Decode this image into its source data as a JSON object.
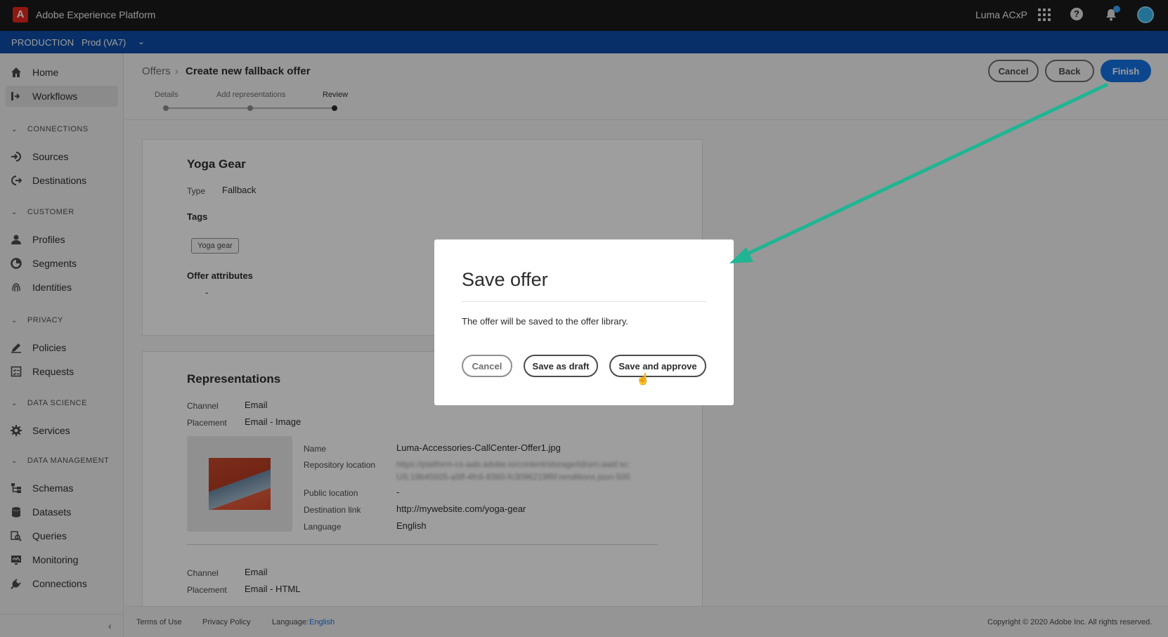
{
  "topbar": {
    "logo": "A",
    "app_title": "Adobe Experience Platform",
    "org_name": "Luma ACxP",
    "help_glyph": "?"
  },
  "envbar": {
    "environment": "PRODUCTION",
    "sandbox": "Prod (VA7)"
  },
  "sidebar": {
    "items": [
      {
        "label": "Home",
        "icon": "home-icon"
      },
      {
        "label": "Workflows",
        "icon": "workflows-icon",
        "active": true
      },
      {
        "section": "CONNECTIONS"
      },
      {
        "label": "Sources",
        "icon": "sources-icon"
      },
      {
        "label": "Destinations",
        "icon": "destinations-icon"
      },
      {
        "section": "CUSTOMER"
      },
      {
        "label": "Profiles",
        "icon": "profiles-icon"
      },
      {
        "label": "Segments",
        "icon": "segments-icon"
      },
      {
        "label": "Identities",
        "icon": "identities-icon"
      },
      {
        "section": "PRIVACY"
      },
      {
        "label": "Policies",
        "icon": "policies-icon"
      },
      {
        "label": "Requests",
        "icon": "requests-icon"
      },
      {
        "section": "DATA SCIENCE"
      },
      {
        "label": "Services",
        "icon": "services-icon"
      },
      {
        "section": "DATA MANAGEMENT"
      },
      {
        "label": "Schemas",
        "icon": "schemas-icon"
      },
      {
        "label": "Datasets",
        "icon": "datasets-icon"
      },
      {
        "label": "Queries",
        "icon": "queries-icon"
      },
      {
        "label": "Monitoring",
        "icon": "monitoring-icon"
      },
      {
        "label": "Connections",
        "icon": "connections-icon"
      }
    ]
  },
  "header": {
    "breadcrumb_root": "Offers",
    "breadcrumb_current": "Create new fallback offer",
    "steps": [
      "Details",
      "Add representations",
      "Review"
    ],
    "current_step": 3,
    "cancel_label": "Cancel",
    "back_label": "Back",
    "finish_label": "Finish"
  },
  "offer": {
    "name": "Yoga Gear",
    "type_label": "Type",
    "type_value": "Fallback",
    "tags_heading": "Tags",
    "tags": [
      "Yoga gear"
    ],
    "attributes_heading": "Offer attributes",
    "attributes_value": "-"
  },
  "representations": {
    "heading": "Representations",
    "channel_label": "Channel",
    "placement_label": "Placement",
    "items": [
      {
        "channel": "Email",
        "placement": "Email - Image",
        "name_label": "Name",
        "name": "Luma-Accessories-CallCenter-Offer1.jpg",
        "repo_label": "Repository location",
        "repo_line1": "https://platform-cs-aab.adobe.io/content/storage/id/urn:aaid:sc:",
        "repo_line2": "US:19b45505-a5ff-4fc6-8360-fc3096219f6f:renditions.json-500",
        "public_label": "Public location",
        "public_value": "-",
        "dest_label": "Destination link",
        "dest_value": "http://mywebsite.com/yoga-gear",
        "lang_label": "Language",
        "lang_value": "English"
      },
      {
        "channel": "Email",
        "placement": "Email - HTML"
      }
    ]
  },
  "footer": {
    "terms": "Terms of Use",
    "privacy": "Privacy Policy",
    "language_label": "Language:",
    "language_value": "English",
    "copyright": "Copyright ©  2020 Adobe Inc. All rights reserved."
  },
  "dialog": {
    "title": "Save offer",
    "body": "The offer will be saved to the offer library.",
    "cancel_label": "Cancel",
    "draft_label": "Save as draft",
    "approve_label": "Save and approve"
  },
  "colors": {
    "accent": "#1473e6",
    "envbar": "#0d4da7",
    "annotation_arrow": "#1fb593"
  }
}
